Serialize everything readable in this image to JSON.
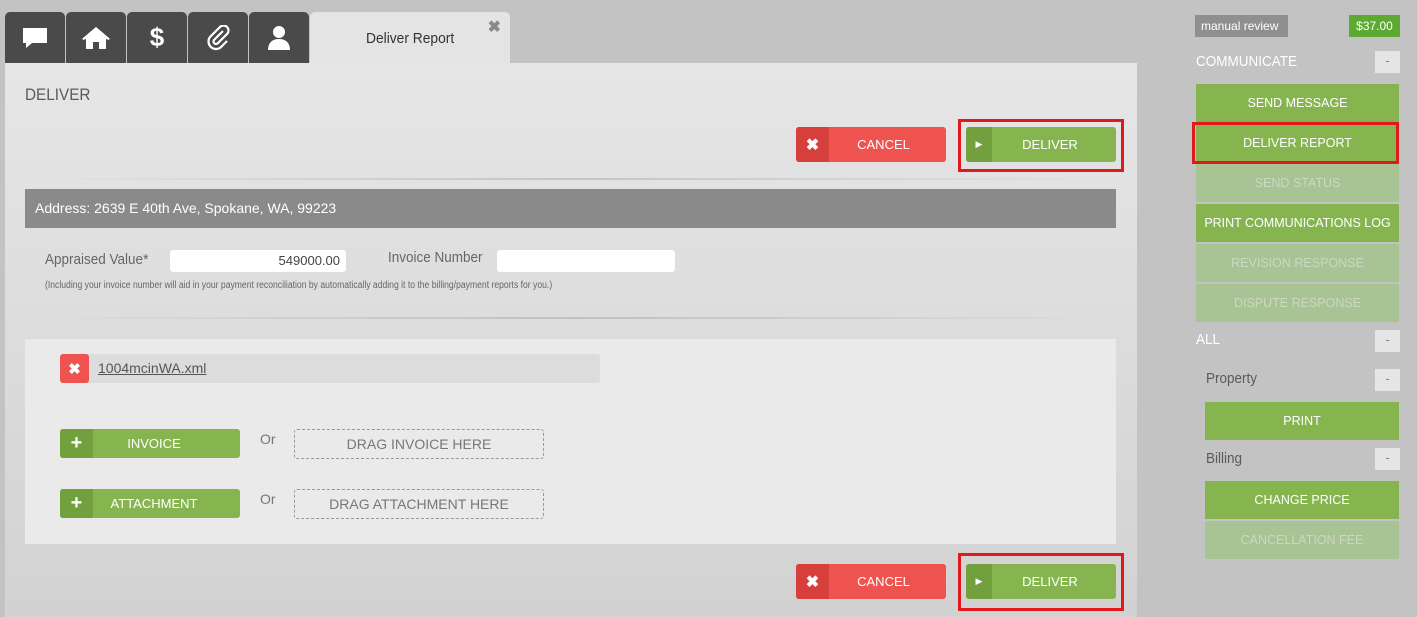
{
  "tabs": [
    {
      "icon": "chat-icon"
    },
    {
      "icon": "home-icon"
    },
    {
      "icon": "dollar-icon"
    },
    {
      "icon": "paperclip-icon"
    },
    {
      "icon": "user-icon"
    }
  ],
  "active_tab": {
    "label": "Deliver Report",
    "close": "✖"
  },
  "page_title": "DELIVER",
  "actions": {
    "cancel_label": "CANCEL",
    "deliver_label": "DELIVER"
  },
  "address": "Address: 2639 E 40th Ave, Spokane, WA, 99223",
  "form": {
    "appraised_label": "Appraised Value*",
    "appraised_value": "549000.00",
    "invoice_label": "Invoice Number",
    "invoice_value": "",
    "note": "(Including your invoice number will aid in your payment reconciliation by automatically adding it to the billing/payment reports for you.)"
  },
  "files": {
    "uploaded": "1004mcinWA.xml",
    "invoice_label": "INVOICE",
    "attachment_label": "ATTACHMENT",
    "or": "Or",
    "drag_invoice": "DRAG INVOICE HERE",
    "drag_attachment": "DRAG ATTACHMENT HERE"
  },
  "sidebar": {
    "status_badge": "manual review",
    "price": "$37.00",
    "communicate_title": "COMMUNICATE",
    "collapse": "-",
    "communicate_items": [
      {
        "label": "SEND MESSAGE",
        "enabled": true
      },
      {
        "label": "DELIVER REPORT",
        "enabled": true
      },
      {
        "label": "SEND STATUS",
        "enabled": false
      },
      {
        "label": "PRINT COMMUNICATIONS LOG",
        "enabled": true
      },
      {
        "label": "REVISION RESPONSE",
        "enabled": false
      },
      {
        "label": "DISPUTE RESPONSE",
        "enabled": false
      }
    ],
    "all_title": "ALL",
    "property_title": "Property",
    "property_items": [
      {
        "label": "PRINT",
        "enabled": true
      }
    ],
    "billing_title": "Billing",
    "billing_items": [
      {
        "label": "CHANGE PRICE",
        "enabled": true
      },
      {
        "label": "CANCELLATION FEE",
        "enabled": false
      }
    ]
  },
  "colors": {
    "accent_green": "#86b550",
    "cancel_red": "#ef5350",
    "highlight": "#e0191d"
  }
}
